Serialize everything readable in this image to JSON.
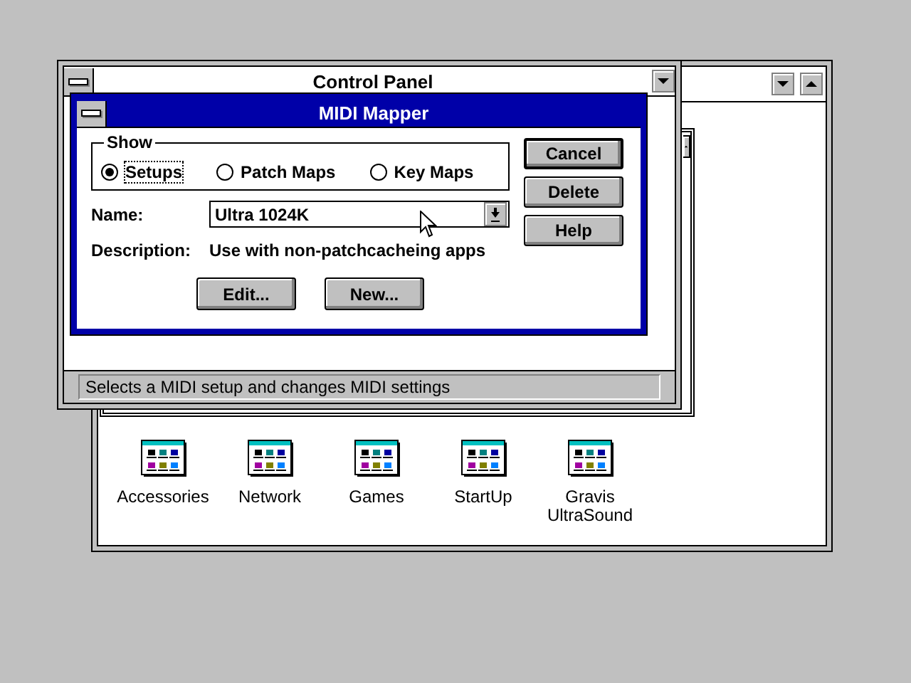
{
  "program_groups": [
    {
      "label": "Accessories"
    },
    {
      "label": "Network"
    },
    {
      "label": "Games"
    },
    {
      "label": "StartUp"
    },
    {
      "label": "Gravis UltraSound"
    }
  ],
  "control_panel": {
    "title": "Control Panel",
    "status_bar": "Selects a MIDI setup and changes MIDI settings"
  },
  "dialog": {
    "title": "MIDI Mapper",
    "show_group": {
      "label": "Show",
      "options": [
        {
          "label": "Setups",
          "selected": true
        },
        {
          "label": "Patch Maps",
          "selected": false
        },
        {
          "label": "Key Maps",
          "selected": false
        }
      ]
    },
    "name": {
      "label": "Name:",
      "value": "Ultra 1024K"
    },
    "description": {
      "label": "Description:",
      "value": "Use with non-patchcacheing apps"
    },
    "bottom_buttons": [
      {
        "label": "Edit..."
      },
      {
        "label": "New..."
      }
    ],
    "side_buttons": [
      {
        "label": "Cancel",
        "default": true
      },
      {
        "label": "Delete",
        "default": false
      },
      {
        "label": "Help",
        "default": false
      }
    ]
  }
}
